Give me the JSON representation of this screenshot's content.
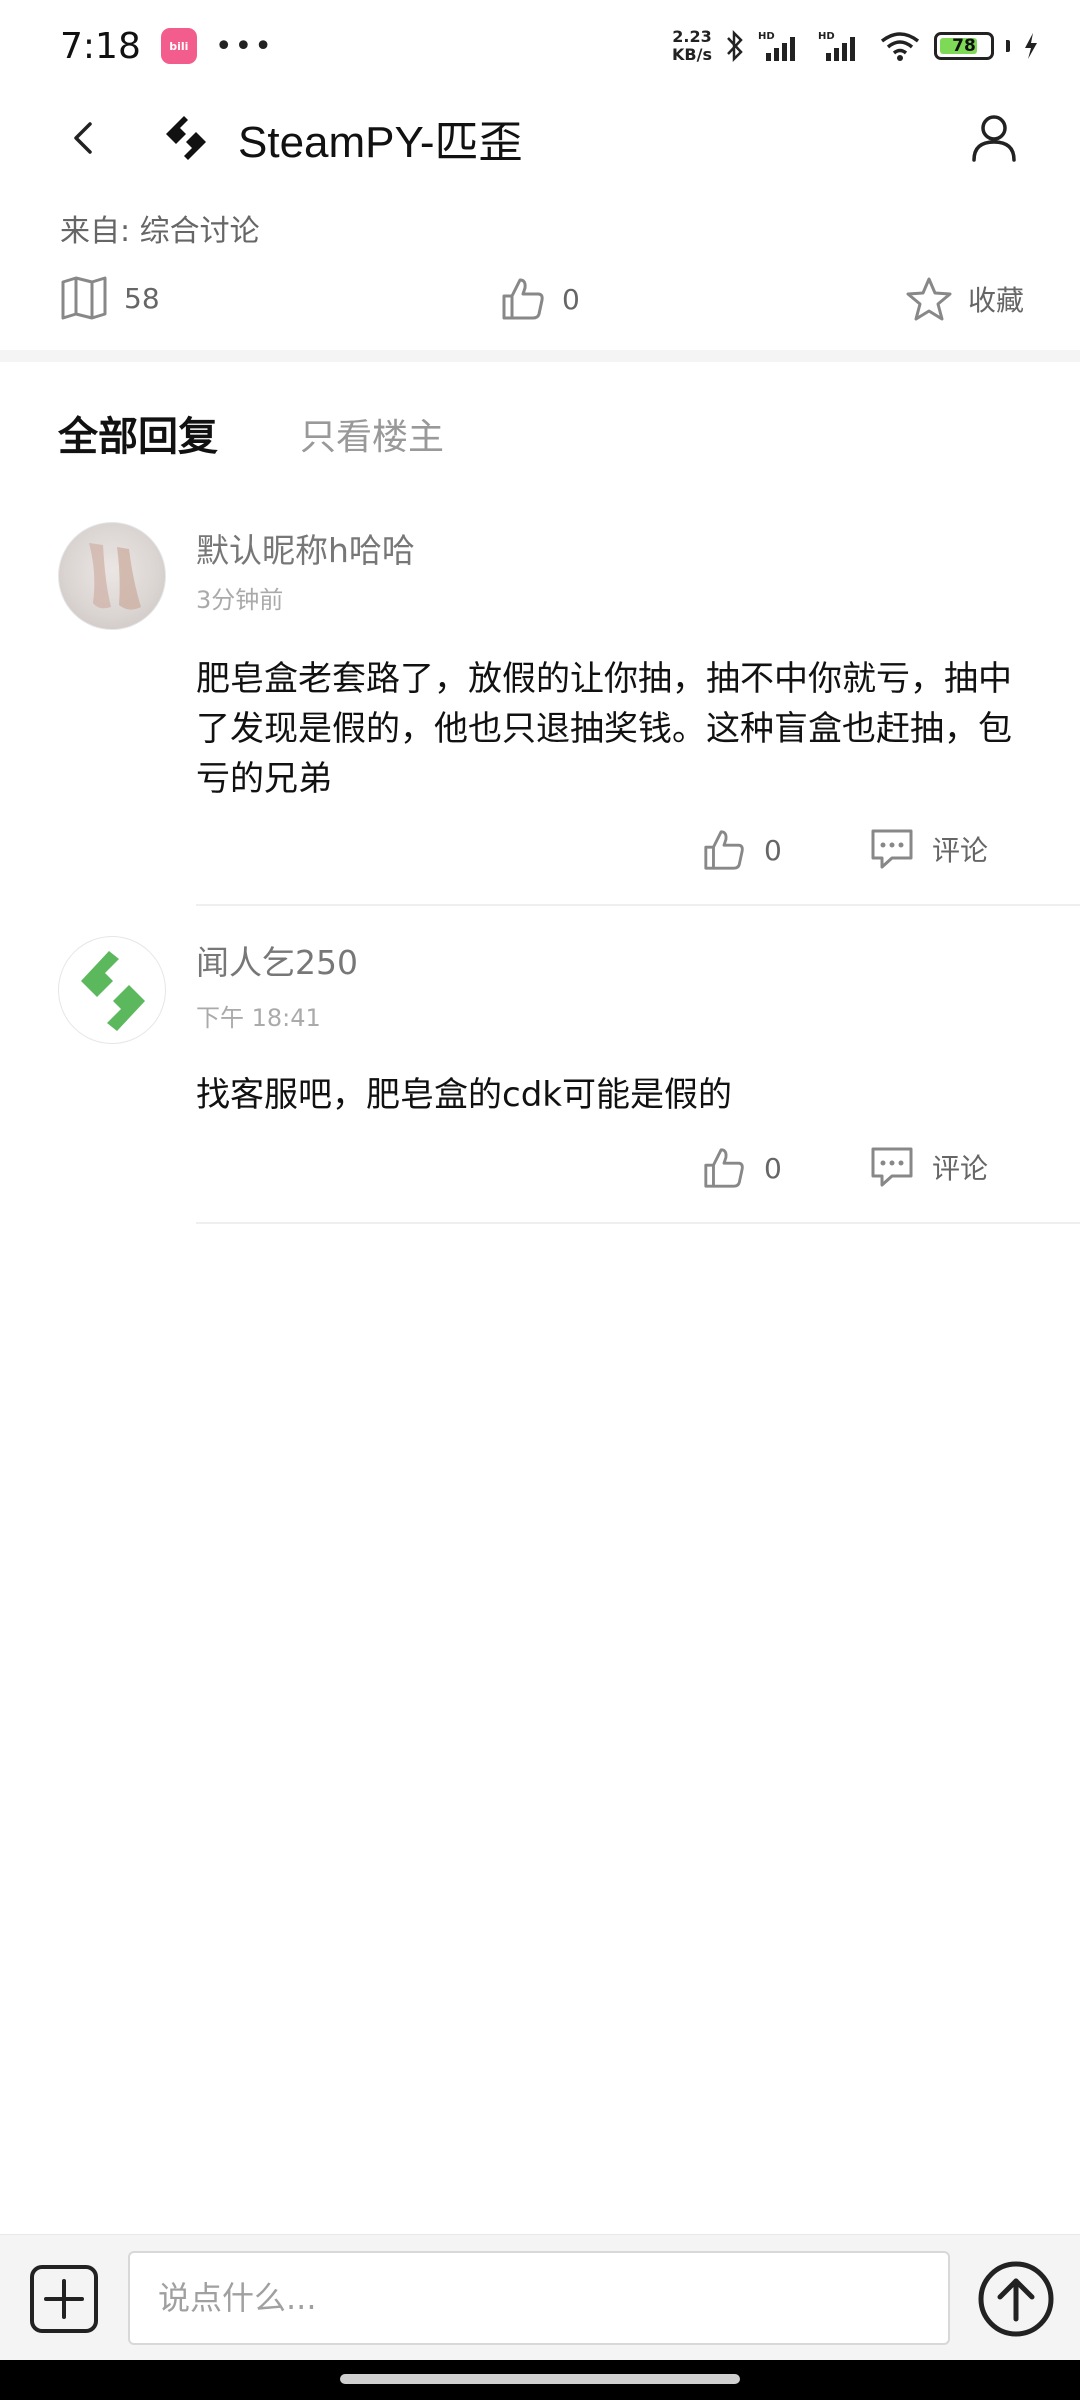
{
  "status_bar": {
    "time": "7:18",
    "app_badge": "bilibili",
    "more_dots": "•••",
    "net_speed_value": "2.23",
    "net_speed_unit": "KB/s",
    "battery_level": "78",
    "battery_fraction": 0.78
  },
  "header": {
    "title": "SteamPY-匹歪"
  },
  "post": {
    "source": "来自: 综合讨论",
    "views": "58",
    "likes": "0",
    "favorite_label": "收藏"
  },
  "tabs": {
    "all_replies": "全部回复",
    "op_only": "只看楼主"
  },
  "replies": [
    {
      "name": "默认昵称h哈哈",
      "time": "3分钟前",
      "content": "肥皂盒老套路了，放假的让你抽，抽不中你就亏，抽中了发现是假的，他也只退抽奖钱。这种盲盒也赶抽，包亏的兄弟",
      "likes": "0",
      "comment_label": "评论"
    },
    {
      "name": "闻人乞250",
      "time": "下午 18:41",
      "content": "找客服吧，肥皂盒的cdk可能是假的",
      "likes": "0",
      "comment_label": "评论"
    }
  ],
  "input_bar": {
    "placeholder": "说点什么..."
  },
  "colors": {
    "brand_green": "#5bb85d",
    "battery_green": "#7ed957",
    "text_primary": "#111111",
    "text_secondary": "#666666"
  }
}
